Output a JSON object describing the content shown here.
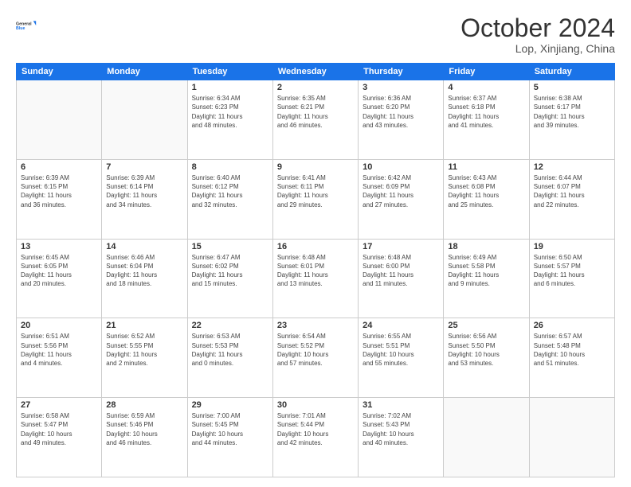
{
  "header": {
    "logo_line1": "General",
    "logo_line2": "Blue",
    "title": "October 2024",
    "subtitle": "Lop, Xinjiang, China"
  },
  "weekdays": [
    "Sunday",
    "Monday",
    "Tuesday",
    "Wednesday",
    "Thursday",
    "Friday",
    "Saturday"
  ],
  "weeks": [
    [
      {
        "day": "",
        "info": ""
      },
      {
        "day": "",
        "info": ""
      },
      {
        "day": "1",
        "info": "Sunrise: 6:34 AM\nSunset: 6:23 PM\nDaylight: 11 hours\nand 48 minutes."
      },
      {
        "day": "2",
        "info": "Sunrise: 6:35 AM\nSunset: 6:21 PM\nDaylight: 11 hours\nand 46 minutes."
      },
      {
        "day": "3",
        "info": "Sunrise: 6:36 AM\nSunset: 6:20 PM\nDaylight: 11 hours\nand 43 minutes."
      },
      {
        "day": "4",
        "info": "Sunrise: 6:37 AM\nSunset: 6:18 PM\nDaylight: 11 hours\nand 41 minutes."
      },
      {
        "day": "5",
        "info": "Sunrise: 6:38 AM\nSunset: 6:17 PM\nDaylight: 11 hours\nand 39 minutes."
      }
    ],
    [
      {
        "day": "6",
        "info": "Sunrise: 6:39 AM\nSunset: 6:15 PM\nDaylight: 11 hours\nand 36 minutes."
      },
      {
        "day": "7",
        "info": "Sunrise: 6:39 AM\nSunset: 6:14 PM\nDaylight: 11 hours\nand 34 minutes."
      },
      {
        "day": "8",
        "info": "Sunrise: 6:40 AM\nSunset: 6:12 PM\nDaylight: 11 hours\nand 32 minutes."
      },
      {
        "day": "9",
        "info": "Sunrise: 6:41 AM\nSunset: 6:11 PM\nDaylight: 11 hours\nand 29 minutes."
      },
      {
        "day": "10",
        "info": "Sunrise: 6:42 AM\nSunset: 6:09 PM\nDaylight: 11 hours\nand 27 minutes."
      },
      {
        "day": "11",
        "info": "Sunrise: 6:43 AM\nSunset: 6:08 PM\nDaylight: 11 hours\nand 25 minutes."
      },
      {
        "day": "12",
        "info": "Sunrise: 6:44 AM\nSunset: 6:07 PM\nDaylight: 11 hours\nand 22 minutes."
      }
    ],
    [
      {
        "day": "13",
        "info": "Sunrise: 6:45 AM\nSunset: 6:05 PM\nDaylight: 11 hours\nand 20 minutes."
      },
      {
        "day": "14",
        "info": "Sunrise: 6:46 AM\nSunset: 6:04 PM\nDaylight: 11 hours\nand 18 minutes."
      },
      {
        "day": "15",
        "info": "Sunrise: 6:47 AM\nSunset: 6:02 PM\nDaylight: 11 hours\nand 15 minutes."
      },
      {
        "day": "16",
        "info": "Sunrise: 6:48 AM\nSunset: 6:01 PM\nDaylight: 11 hours\nand 13 minutes."
      },
      {
        "day": "17",
        "info": "Sunrise: 6:48 AM\nSunset: 6:00 PM\nDaylight: 11 hours\nand 11 minutes."
      },
      {
        "day": "18",
        "info": "Sunrise: 6:49 AM\nSunset: 5:58 PM\nDaylight: 11 hours\nand 9 minutes."
      },
      {
        "day": "19",
        "info": "Sunrise: 6:50 AM\nSunset: 5:57 PM\nDaylight: 11 hours\nand 6 minutes."
      }
    ],
    [
      {
        "day": "20",
        "info": "Sunrise: 6:51 AM\nSunset: 5:56 PM\nDaylight: 11 hours\nand 4 minutes."
      },
      {
        "day": "21",
        "info": "Sunrise: 6:52 AM\nSunset: 5:55 PM\nDaylight: 11 hours\nand 2 minutes."
      },
      {
        "day": "22",
        "info": "Sunrise: 6:53 AM\nSunset: 5:53 PM\nDaylight: 11 hours\nand 0 minutes."
      },
      {
        "day": "23",
        "info": "Sunrise: 6:54 AM\nSunset: 5:52 PM\nDaylight: 10 hours\nand 57 minutes."
      },
      {
        "day": "24",
        "info": "Sunrise: 6:55 AM\nSunset: 5:51 PM\nDaylight: 10 hours\nand 55 minutes."
      },
      {
        "day": "25",
        "info": "Sunrise: 6:56 AM\nSunset: 5:50 PM\nDaylight: 10 hours\nand 53 minutes."
      },
      {
        "day": "26",
        "info": "Sunrise: 6:57 AM\nSunset: 5:48 PM\nDaylight: 10 hours\nand 51 minutes."
      }
    ],
    [
      {
        "day": "27",
        "info": "Sunrise: 6:58 AM\nSunset: 5:47 PM\nDaylight: 10 hours\nand 49 minutes."
      },
      {
        "day": "28",
        "info": "Sunrise: 6:59 AM\nSunset: 5:46 PM\nDaylight: 10 hours\nand 46 minutes."
      },
      {
        "day": "29",
        "info": "Sunrise: 7:00 AM\nSunset: 5:45 PM\nDaylight: 10 hours\nand 44 minutes."
      },
      {
        "day": "30",
        "info": "Sunrise: 7:01 AM\nSunset: 5:44 PM\nDaylight: 10 hours\nand 42 minutes."
      },
      {
        "day": "31",
        "info": "Sunrise: 7:02 AM\nSunset: 5:43 PM\nDaylight: 10 hours\nand 40 minutes."
      },
      {
        "day": "",
        "info": ""
      },
      {
        "day": "",
        "info": ""
      }
    ]
  ]
}
